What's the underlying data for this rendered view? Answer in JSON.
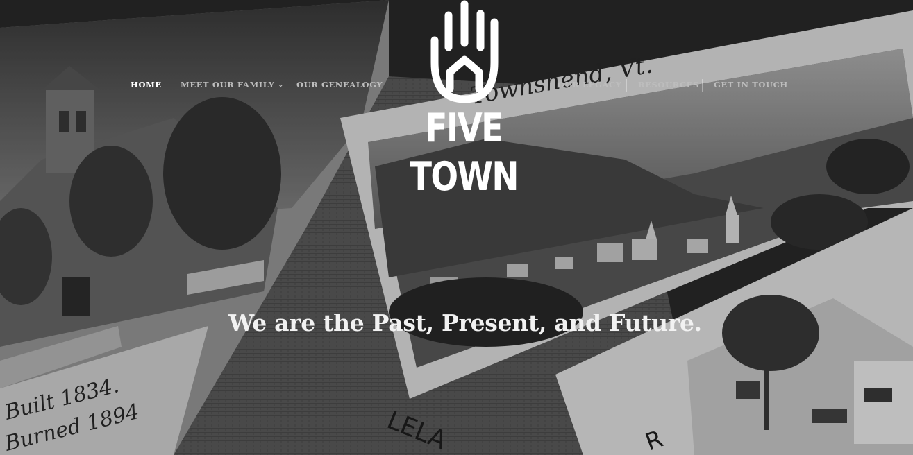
{
  "nav": {
    "home": "HOME",
    "meet_our_family": "MEET OUR FAMILY",
    "our_genealogy": "OUR GENEALOGY",
    "our_legacy": "OUR LEGACY",
    "resources": "RESOURCES",
    "get_in_touch": "GET IN TOUCH",
    "dropdown_icon": "chevron-down-icon"
  },
  "logo": {
    "text": "FIVE TOWN",
    "icon": "hand-house-icon"
  },
  "hero": {
    "tagline": "We are the Past, Present, and Future.",
    "photo_text": {
      "townshend": "Townshend, Vt.",
      "built": "Built 1834.",
      "burned": "Burned 1894",
      "leland": "LELA",
      "r": "R"
    }
  },
  "colors": {
    "nav_active": "#ffffff",
    "nav_default": "#bdbdbd",
    "logo": "#ffffff"
  }
}
